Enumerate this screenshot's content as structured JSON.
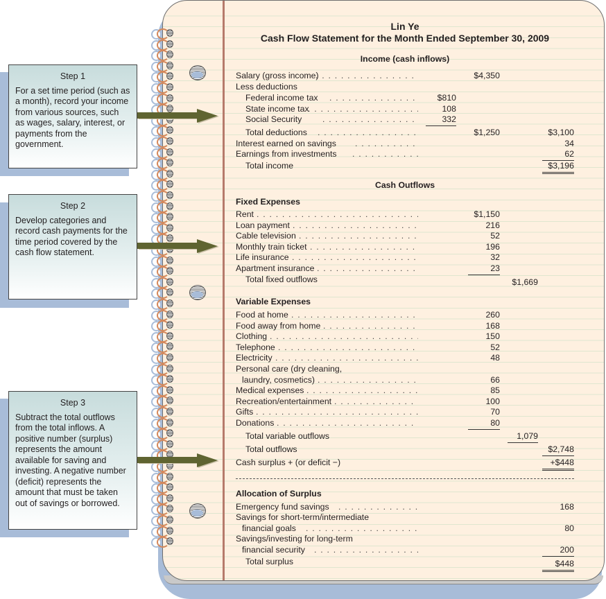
{
  "header": {
    "name": "Lin Ye",
    "title": "Cash Flow Statement for the Month Ended September 30, 2009"
  },
  "steps": [
    {
      "title": "Step 1",
      "text": "For a set time period (such as a month), record your income from various sources, such as wages, salary, interest, or payments from the government."
    },
    {
      "title": "Step 2",
      "text": "Develop categories and record cash payments for the time period covered by the cash flow statement."
    },
    {
      "title": "Step 3",
      "text": "Subtract the total outflows from the total inflows. A positive number (surplus) represents the amount available for saving and investing. A negative number (deficit) represents the amount that must be taken out of savings or borrowed."
    }
  ],
  "income": {
    "heading": "Income (cash inflows)",
    "salary": {
      "label": "Salary (gross income)",
      "value": "$4,350"
    },
    "less_deductions": "Less deductions",
    "deductions": [
      {
        "label": "Federal income tax",
        "value": "$810"
      },
      {
        "label": "State income tax",
        "value": "108"
      },
      {
        "label": "Social Security",
        "value": "332"
      }
    ],
    "total_deductions": {
      "label": "Total deductions",
      "value": "$1,250",
      "net": "$3,100"
    },
    "interest": {
      "label": "Interest earned on savings",
      "value": "34"
    },
    "investments": {
      "label": "Earnings from investments",
      "value": "62"
    },
    "total_income": {
      "label": "Total income",
      "value": "$3,196"
    }
  },
  "outflows": {
    "heading": "Cash Outflows",
    "fixed": {
      "heading": "Fixed Expenses",
      "items": [
        {
          "label": "Rent",
          "value": "$1,150"
        },
        {
          "label": "Loan payment",
          "value": "216"
        },
        {
          "label": "Cable television",
          "value": "52"
        },
        {
          "label": "Monthly train ticket",
          "value": "196"
        },
        {
          "label": "Life insurance",
          "value": "32"
        },
        {
          "label": "Apartment insurance",
          "value": "23"
        }
      ],
      "total": {
        "label": "Total fixed outflows",
        "value": "$1,669"
      }
    },
    "variable": {
      "heading": "Variable Expenses",
      "items": [
        {
          "label": "Food at home",
          "value": "260"
        },
        {
          "label": "Food away from home",
          "value": "168"
        },
        {
          "label": "Clothing",
          "value": "150"
        },
        {
          "label": "Telephone",
          "value": "52"
        },
        {
          "label": "Electricity",
          "value": "48"
        },
        {
          "label": "Personal care (dry cleaning,",
          "label2": "laundry, cosmetics)",
          "value": "66"
        },
        {
          "label": "Medical expenses",
          "value": "85"
        },
        {
          "label": "Recreation/entertainment",
          "value": "100"
        },
        {
          "label": "Gifts",
          "value": "70"
        },
        {
          "label": "Donations",
          "value": "80"
        }
      ],
      "total": {
        "label": "Total variable outflows",
        "value": "1,079"
      }
    },
    "total": {
      "label": "Total outflows",
      "value": "$2,748"
    },
    "surplus": {
      "label": "Cash surplus + (or deficit −)",
      "value": "+$448"
    }
  },
  "allocation": {
    "heading": "Allocation of Surplus",
    "items": [
      {
        "label": "Emergency fund savings",
        "value": "168"
      },
      {
        "label": "Savings for short-term/intermediate",
        "label2": "financial goals",
        "value": "80"
      },
      {
        "label": "Savings/investing for long-term",
        "label2": "financial security",
        "value": "200"
      }
    ],
    "total": {
      "label": "Total surplus",
      "value": "$448"
    }
  }
}
